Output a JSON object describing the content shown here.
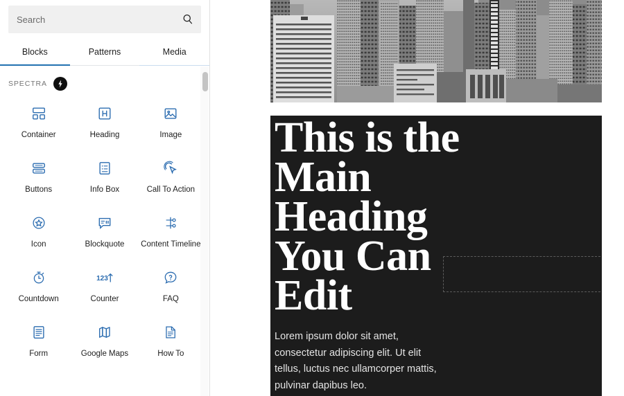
{
  "inserter": {
    "search": {
      "placeholder": "Search",
      "value": "",
      "icon": "search-icon"
    },
    "tabs": [
      {
        "label": "Blocks",
        "active": true
      },
      {
        "label": "Patterns",
        "active": false
      },
      {
        "label": "Media",
        "active": false
      }
    ],
    "category": {
      "title": "SPECTRA",
      "badge_icon": "lightning-bolt-icon"
    },
    "blocks": [
      {
        "label": "Container",
        "icon": "container-icon"
      },
      {
        "label": "Heading",
        "icon": "heading-icon"
      },
      {
        "label": "Image",
        "icon": "image-icon"
      },
      {
        "label": "Buttons",
        "icon": "buttons-icon"
      },
      {
        "label": "Info Box",
        "icon": "info-box-icon"
      },
      {
        "label": "Call To Action",
        "icon": "call-to-action-icon"
      },
      {
        "label": "Icon",
        "icon": "icon-star-icon"
      },
      {
        "label": "Blockquote",
        "icon": "blockquote-icon"
      },
      {
        "label": "Content Timeline",
        "icon": "content-timeline-icon"
      },
      {
        "label": "Countdown",
        "icon": "countdown-icon"
      },
      {
        "label": "Counter",
        "icon": "counter-icon"
      },
      {
        "label": "FAQ",
        "icon": "faq-icon"
      },
      {
        "label": "Form",
        "icon": "form-icon"
      },
      {
        "label": "Google Maps",
        "icon": "google-maps-icon"
      },
      {
        "label": "How To",
        "icon": "how-to-icon"
      }
    ],
    "accent_color": "#2271b1",
    "icon_color": "#2b6cb0"
  },
  "canvas": {
    "hero_image": {
      "alt": "cityscape-photo",
      "style": "grayscale"
    },
    "dark_block": {
      "background_color": "#1c1c1c",
      "heading": "This is the Main Heading You Can Edit",
      "paragraph": "Lorem ipsum dolor sit amet, consectetur adipiscing elit. Ut elit tellus, luctus nec ullamcorper mattis, pulvinar dapibus leo.",
      "placeholder_block": ""
    }
  }
}
